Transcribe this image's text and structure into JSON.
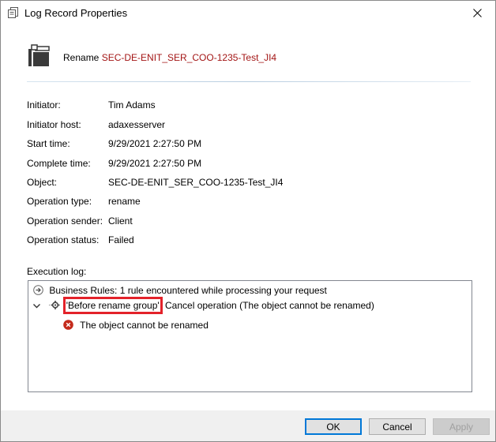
{
  "window": {
    "title": "Log Record Properties"
  },
  "header": {
    "action": "Rename",
    "object_name": "SEC-DE-ENIT_SER_COO-1235-Test_JI4"
  },
  "properties": [
    {
      "label": "Initiator:",
      "value": "Tim Adams"
    },
    {
      "label": "Initiator host:",
      "value": "adaxesserver"
    },
    {
      "label": "Start time:",
      "value": "9/29/2021 2:27:50 PM"
    },
    {
      "label": "Complete time:",
      "value": "9/29/2021 2:27:50 PM"
    },
    {
      "label": "Object:",
      "value": "SEC-DE-ENIT_SER_COO-1235-Test_JI4"
    },
    {
      "label": "Operation type:",
      "value": "rename"
    },
    {
      "label": "Operation sender:",
      "value": "Client"
    },
    {
      "label": "Operation status:",
      "value": "Failed"
    }
  ],
  "execution_log": {
    "label": "Execution log:",
    "entries": [
      {
        "text": "Business Rules: 1 rule encountered while processing your request",
        "icon": "arrow-right-circle-icon"
      },
      {
        "rule_name": "'Before rename group'",
        "text": " Cancel operation (The object cannot be renamed)",
        "icon": "gear-icon",
        "expanded": true
      },
      {
        "text": "The object cannot be renamed",
        "icon": "error-icon"
      }
    ]
  },
  "buttons": {
    "ok": "OK",
    "cancel": "Cancel",
    "apply": "Apply"
  },
  "colors": {
    "object_name": "#a31515",
    "highlight": "#e3222a",
    "error": "#c42b1c",
    "default_button": "#0078d7"
  }
}
